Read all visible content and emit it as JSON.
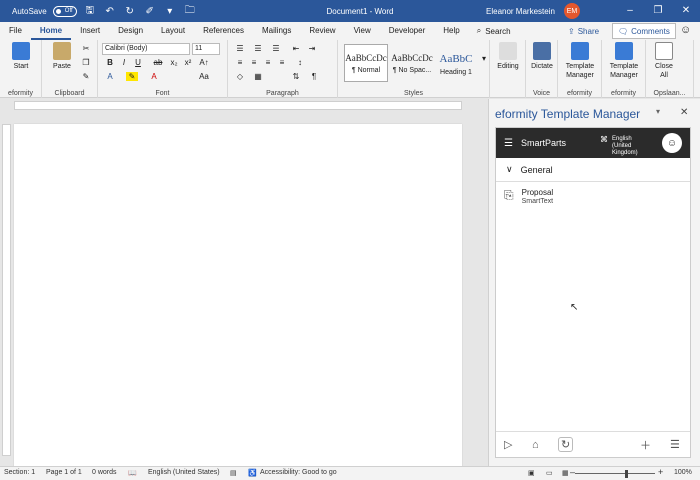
{
  "titlebar": {
    "autosave_label": "AutoSave",
    "autosave_state": "Off",
    "doc_title": "Document1  -  Word",
    "user_name": "Eleanor Markestein",
    "user_initials": "EM",
    "quick_access": [
      "save-icon",
      "undo-icon",
      "redo-icon",
      "format-icon",
      "dropdown-icon",
      "folder-icon"
    ],
    "window_controls": [
      "minimize",
      "restore",
      "close"
    ]
  },
  "tabs": [
    "File",
    "Home",
    "Insert",
    "Design",
    "Layout",
    "References",
    "Mailings",
    "Review",
    "View",
    "Developer",
    "Help"
  ],
  "active_tab": "Home",
  "search_label": "Search",
  "share_label": "Share",
  "comments_label": "Comments",
  "ribbon": {
    "eformity_start_label": "Start",
    "eformity_group": "eformity",
    "clipboard": {
      "paste_label": "Paste",
      "group_label": "Clipboard"
    },
    "font": {
      "family": "Calibri (Body)",
      "size": "11",
      "group_label": "Font"
    },
    "paragraph": {
      "group_label": "Paragraph"
    },
    "styles": {
      "group_label": "Styles",
      "items": [
        {
          "sample": "AaBbCcDc",
          "name": "¶ Normal"
        },
        {
          "sample": "AaBbCcDc",
          "name": "¶ No Spac..."
        },
        {
          "sample": "AaBbC",
          "name": "Heading 1"
        }
      ]
    },
    "editing_label": "Editing",
    "dictate_label": "Dictate",
    "voice_group": "Voice",
    "template_manager_label": "Template Manager",
    "template_manager2_label": "Template Manager",
    "eformity_group2": "eformity",
    "eformity_group3": "eformity",
    "close_all_label": "Close All",
    "opslaan_group": "Opslaan..."
  },
  "pane": {
    "title": "eformity Template Manager",
    "addin_title": "SmartParts",
    "language": "English (United Kingdom)",
    "section": "General",
    "item_title": "Proposal",
    "item_subtitle": "SmartText"
  },
  "status": {
    "section": "Section: 1",
    "page": "Page 1 of 1",
    "words": "0 words",
    "language": "English (United States)",
    "accessibility": "Accessibility: Good to go",
    "zoom": "100%"
  },
  "colors": {
    "word_blue": "#2b579a",
    "addin_dark": "#2b2b2b",
    "avatar": "#e4572e"
  }
}
